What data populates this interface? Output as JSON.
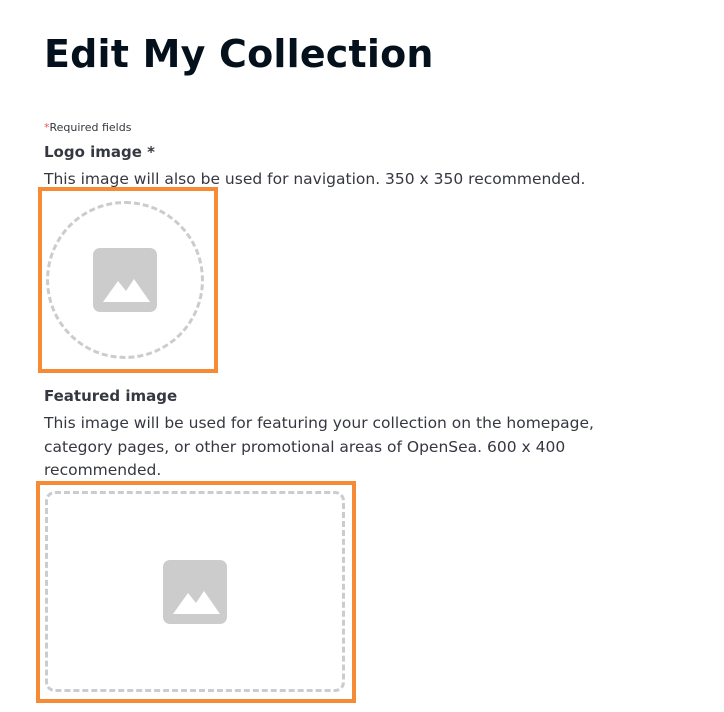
{
  "page": {
    "title": "Edit My Collection",
    "required_star": "*",
    "required_text": "Required fields"
  },
  "logo_field": {
    "label": "Logo image *",
    "description": "This image will also be used for navigation. 350 x 350 recommended.",
    "icon": "image-icon"
  },
  "featured_field": {
    "label": "Featured image",
    "description": "This image will be used for featuring your collection on the homepage, category pages, or other promotional areas of OpenSea. 600 x 400 recommended.",
    "icon": "image-icon"
  },
  "colors": {
    "highlight": "#f68a35",
    "dashed_border": "#cccccc",
    "icon": "#cccccc",
    "required_star": "#eb5757",
    "text": "#353840"
  }
}
